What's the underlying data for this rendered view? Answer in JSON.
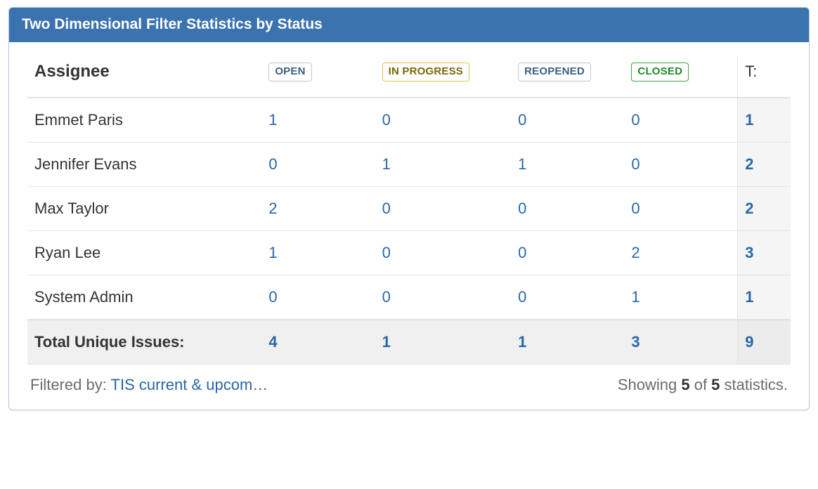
{
  "gadget": {
    "title": "Two Dimensional Filter Statistics by Status"
  },
  "columns": {
    "assignee_header": "Assignee",
    "statuses": [
      {
        "key": "open",
        "label": "OPEN",
        "style": "lz-open"
      },
      {
        "key": "inprogress",
        "label": "IN PROGRESS",
        "style": "lz-prog"
      },
      {
        "key": "reopened",
        "label": "REOPENED",
        "style": "lz-reop"
      },
      {
        "key": "closed",
        "label": "CLOSED",
        "style": "lz-closed"
      }
    ],
    "total_header": "T:"
  },
  "rows": [
    {
      "assignee": "Emmet Paris",
      "values": [
        1,
        0,
        0,
        0
      ],
      "total": 1
    },
    {
      "assignee": "Jennifer Evans",
      "values": [
        0,
        1,
        1,
        0
      ],
      "total": 2
    },
    {
      "assignee": "Max Taylor",
      "values": [
        2,
        0,
        0,
        0
      ],
      "total": 2
    },
    {
      "assignee": "Ryan Lee",
      "values": [
        1,
        0,
        0,
        2
      ],
      "total": 3
    },
    {
      "assignee": "System Admin",
      "values": [
        0,
        0,
        0,
        1
      ],
      "total": 1
    }
  ],
  "totals": {
    "label": "Total Unique Issues:",
    "values": [
      4,
      1,
      1,
      3
    ],
    "grand": 9
  },
  "footer": {
    "filtered_by_label": "Filtered by: ",
    "filter_name": "TIS current & upcom…",
    "showing_prefix": "Showing ",
    "showing_n": "5",
    "showing_of": " of ",
    "showing_total": "5",
    "showing_suffix": " statistics."
  },
  "chart_data": {
    "type": "table",
    "title": "Two Dimensional Filter Statistics by Status",
    "row_dimension": "Assignee",
    "column_dimension": "Status",
    "columns": [
      "OPEN",
      "IN PROGRESS",
      "REOPENED",
      "CLOSED"
    ],
    "rows": [
      "Emmet Paris",
      "Jennifer Evans",
      "Max Taylor",
      "Ryan Lee",
      "System Admin"
    ],
    "values": [
      [
        1,
        0,
        0,
        0
      ],
      [
        0,
        1,
        1,
        0
      ],
      [
        2,
        0,
        0,
        0
      ],
      [
        1,
        0,
        0,
        2
      ],
      [
        0,
        0,
        0,
        1
      ]
    ],
    "row_totals": [
      1,
      2,
      2,
      3,
      1
    ],
    "column_totals": [
      4,
      1,
      1,
      3
    ],
    "grand_total": 9
  }
}
